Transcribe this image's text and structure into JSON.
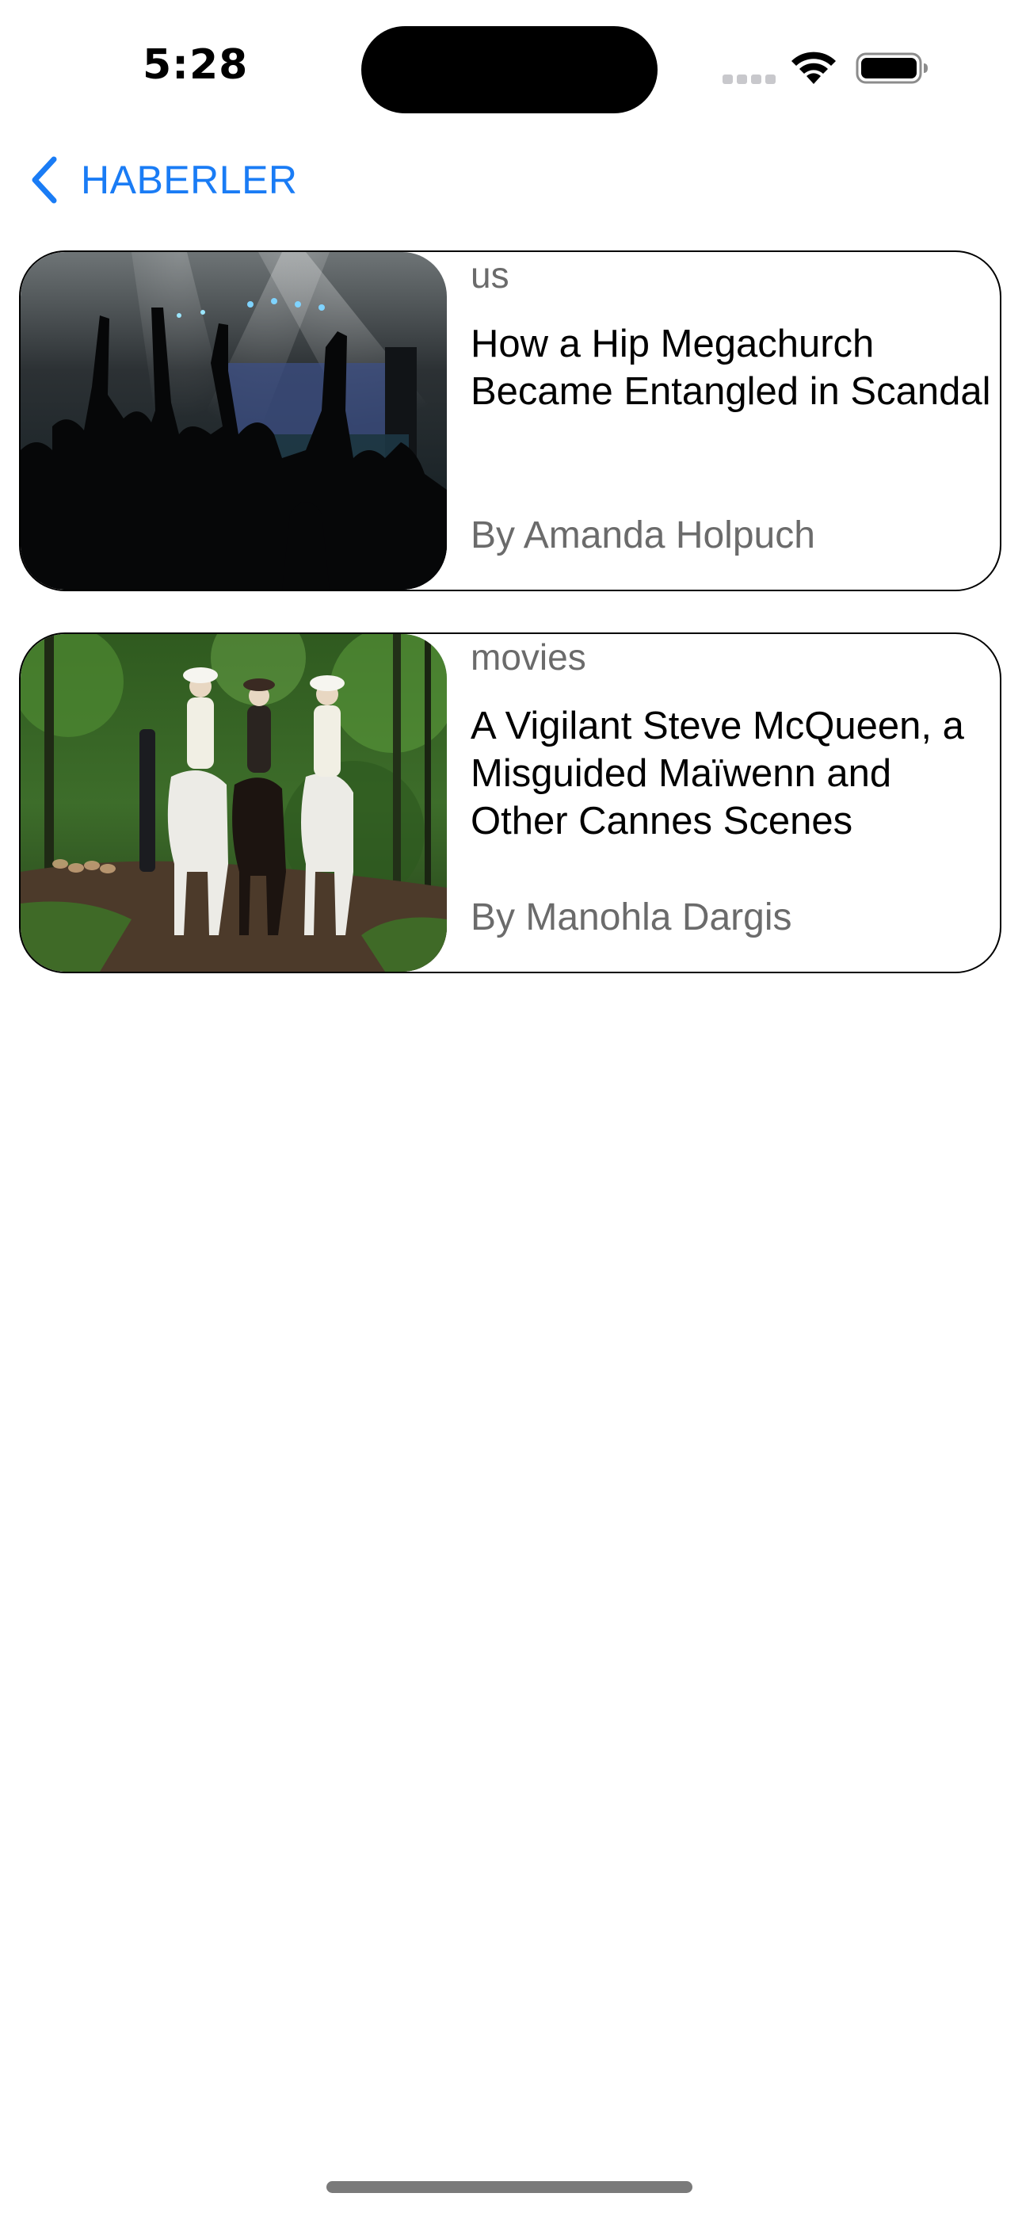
{
  "status_bar": {
    "time": "5:28",
    "icons": [
      "cellular-signal-icon",
      "wifi-icon",
      "battery-icon"
    ]
  },
  "nav": {
    "back_label": "HABERLER",
    "back_icon": "chevron-left-icon",
    "accent_color": "#1a7cf5"
  },
  "articles": [
    {
      "section": "us",
      "title": "How a Hip Megachurch Became Entangled in Scandal",
      "byline": "By Amanda Holpuch",
      "image": "concert-crowd-photo"
    },
    {
      "section": "movies",
      "title": "A Vigilant Steve McQueen, a Misguided Maïwenn and Other Cannes Scenes",
      "byline": "By Manohla Dargis",
      "image": "horse-riders-forest-photo"
    }
  ]
}
